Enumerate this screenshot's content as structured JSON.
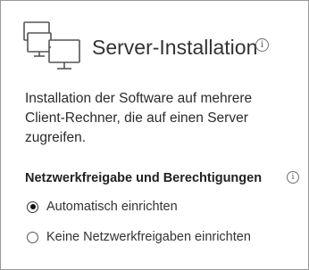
{
  "header": {
    "icon": "computers-network-icon",
    "title": "Server-Installation",
    "info_icon": "info-icon"
  },
  "description": "Installation der Software auf mehrere Client-Rechner, die auf einen Server zugreifen.",
  "network_section": {
    "title": "Netzwerkfreigabe und Berechtigungen",
    "info_icon": "info-icon",
    "options": [
      {
        "label": "Automatisch einrichten",
        "selected": true
      },
      {
        "label": "Keine Netzwerkfreigaben einrichten",
        "selected": false
      }
    ]
  }
}
